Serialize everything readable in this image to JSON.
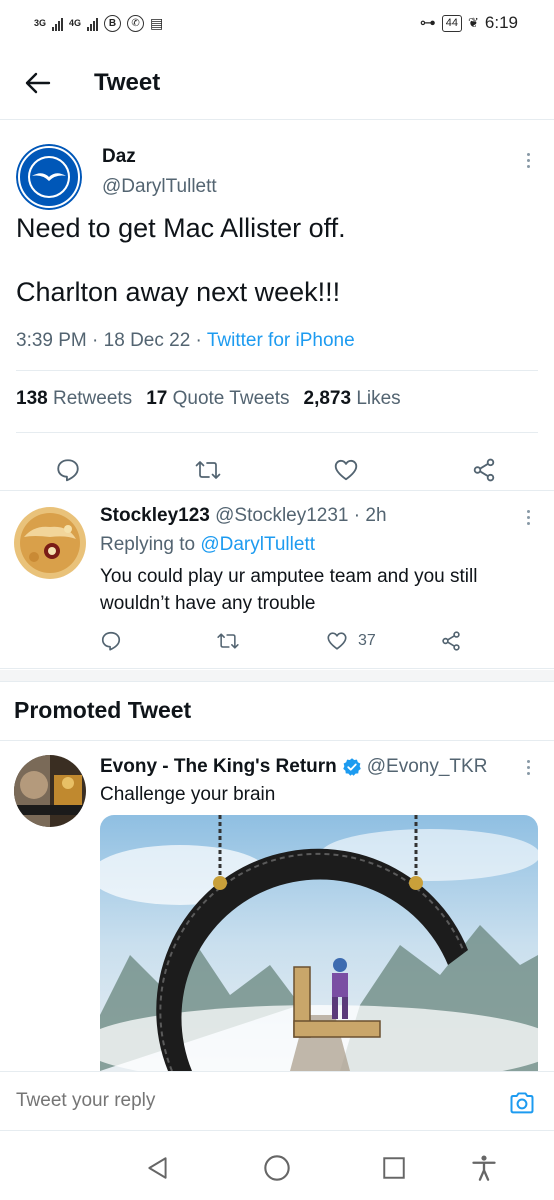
{
  "status_bar": {
    "net1": "3G",
    "net2": "4G",
    "badge": "B",
    "battery": "44",
    "time": "6:19"
  },
  "header": {
    "title": "Tweet"
  },
  "main_tweet": {
    "name": "Daz",
    "handle": "@DarylTullett",
    "text": "Need to get Mac Allister off.\n\nCharlton away next week!!!",
    "time": "3:39 PM",
    "date": "18 Dec 22",
    "source": "Twitter for iPhone",
    "stats": {
      "retweets_count": "138",
      "retweets_label": "Retweets",
      "quotes_count": "17",
      "quotes_label": "Quote Tweets",
      "likes_count": "2,873",
      "likes_label": "Likes"
    }
  },
  "reply": {
    "name": "Stockley123",
    "handle": "@Stockley1231",
    "time": "2h",
    "replying_label": "Replying to",
    "replying_to": "@DarylTullett",
    "text": "You could play ur amputee team and you still wouldn’t have any trouble",
    "likes": "37"
  },
  "promoted": {
    "title": "Promoted Tweet",
    "name": "Evony - The King's Return",
    "handle": "@Evony_TKR",
    "text": "Challenge your brain"
  },
  "reply_bar": {
    "placeholder": "Tweet your reply"
  },
  "colors": {
    "accent": "#1d9bf0",
    "secondary_text": "#536471",
    "divider": "#e6ecf0"
  }
}
